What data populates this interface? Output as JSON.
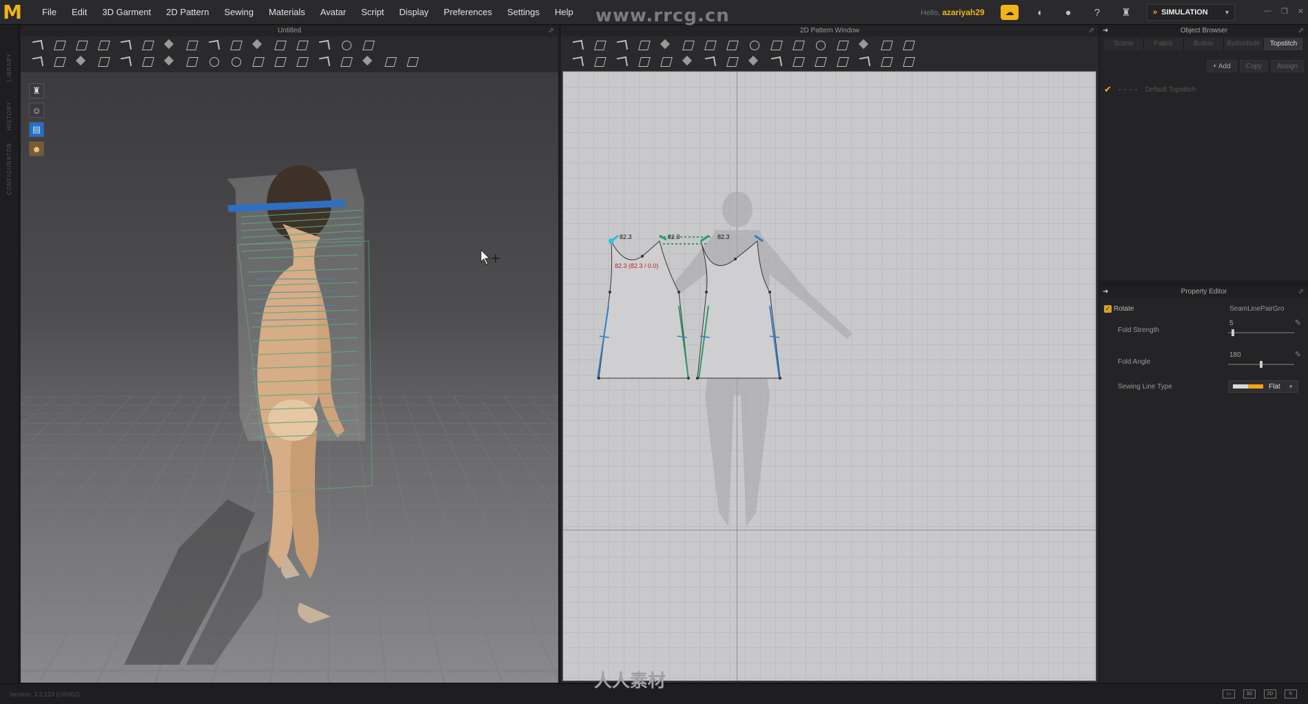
{
  "app": {
    "logo": "M",
    "menu": [
      "File",
      "Edit",
      "3D Garment",
      "2D Pattern",
      "Sewing",
      "Materials",
      "Avatar",
      "Script",
      "Display",
      "Preferences",
      "Settings",
      "Help"
    ],
    "watermark_top": "www.rrcg.cn",
    "user_prefix": "Hello,",
    "username": "azariyah29",
    "mode_label": "SIMULATION",
    "accent_color": "#f2b316"
  },
  "left_strip": {
    "labels": [
      "LIBRARY",
      "HISTORY",
      "CONFIGURATOR"
    ]
  },
  "panel_3d": {
    "title": "Untitled"
  },
  "panel_2d": {
    "title": "2D Pattern Window",
    "measure_1": "82.3",
    "measure_2": "82.3",
    "measure_3": "82.3",
    "measure_red": "82.3 (82.3 / 0.0)"
  },
  "object_browser": {
    "title": "Object Browser",
    "tabs": [
      "Scene",
      "Fabric",
      "Button",
      "Buttonhole",
      "Topstitch"
    ],
    "active_tab": "Topstitch",
    "buttons": {
      "add": "+ Add",
      "copy": "Copy",
      "assign": "Assign"
    },
    "item": "Default Topstitch"
  },
  "property_editor": {
    "title": "Property Editor",
    "rotate_label": "Rotate",
    "rotate_value": "SeamLinePairGro",
    "fold_strength_label": "Fold Strength",
    "fold_strength_value": "5",
    "fold_strength_fraction": 0.05,
    "fold_angle_label": "Fold Angle",
    "fold_angle_value": "180",
    "fold_angle_fraction": 0.5,
    "sewing_line_type_label": "Sewing Line Type",
    "sewing_line_type_value": "Flat"
  },
  "status": {
    "version": "Version: 3.2.123     (r30062)",
    "view_buttons": [
      "▭",
      "3D",
      "2D",
      "↻"
    ]
  },
  "watermark_bottom": "人人素材"
}
